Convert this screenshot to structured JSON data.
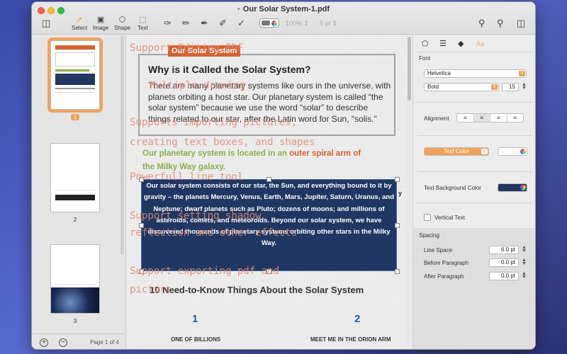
{
  "window": {
    "title": "Our Solar System-1.pdf",
    "edited_marker": "•"
  },
  "toolbar": {
    "select_label": "Select",
    "image_label": "Image",
    "shape_label": "Shape",
    "text_label": "Text",
    "opacity_value": "100%",
    "stroke_value": "5 pt"
  },
  "thumbnails": {
    "pages": [
      {
        "label": "1",
        "selected": true
      },
      {
        "label": "2",
        "selected": false
      },
      {
        "label": "3",
        "selected": false
      }
    ],
    "page_indicator": "Page 1 of 4",
    "add_symbol": "+",
    "remove_symbol": "−"
  },
  "document": {
    "tag": "Our Solar System",
    "heading": "Why is it Called the Solar System?",
    "paragraph": "There are many planetary systems like ours in the universe, with planets orbiting a host star. Our planetary system is called “the solar system” because we use the word “solar” to describe things related to our star, after the Latin word for Sun, \"solis.\"",
    "green_line_part1": "Our planetary system is located in an ",
    "green_line_part2": "outer spiral arm of",
    "green_line_part3": "the Milky Way galaxy.",
    "navy_text": "Our solar system consists of our star, the Sun, and everything bound to it by gravity – the planets Mercury, Venus, Earth, Mars, Jupiter, Saturn, Uranus, and Neptune; dwarf planets such as Pluto; dozens of moons; and millions of asteroids, comets, and meteoroids. Beyond our solar system, we have discovered thousands of planetary systems orbiting other stars in the Milky Way.",
    "side_fragment": "y",
    "heading2": "10 Need-to-Know Things About the Solar System",
    "item1_number": "1",
    "item1_caption": "ONE OF BILLIONS",
    "item2_number": "2",
    "item2_caption": "MEET ME IN THE ORION ARM"
  },
  "overlay_features": [
    "Support Editing PDF",
    "Multiple drawing",
    "Supports importing pictures,",
    "creating text boxes, and shapes",
    "Powerfull line tool",
    "Support setting shadow",
    "reflection and other effects",
    "Support exporting pdf and",
    "picture"
  ],
  "inspector": {
    "font_section": "Font",
    "font_family": "Helvetica",
    "font_style": "Bold",
    "font_size": "15",
    "alignment_label": "Alignment",
    "text_color_label": "Text Color",
    "text_bg_label": "Text Background Color",
    "text_bg_color": "#1f3762",
    "vertical_text_label": "Vertical Text",
    "spacing_section": "Spacing",
    "line_space_label": "Line Space",
    "line_space_value": "6.0 pt",
    "before_para_label": "Before Paragraph",
    "before_para_value": "0.0 pt",
    "after_para_label": "After Paragraph",
    "after_para_value": "0.0 pt",
    "tab_text_glyph": "Aa"
  },
  "colors": {
    "accent": "#f0a25a",
    "tag_orange": "#d5622f",
    "green_text": "#8bb04b",
    "navy_box": "#1f3762",
    "overlay_text": "#e48a72"
  }
}
